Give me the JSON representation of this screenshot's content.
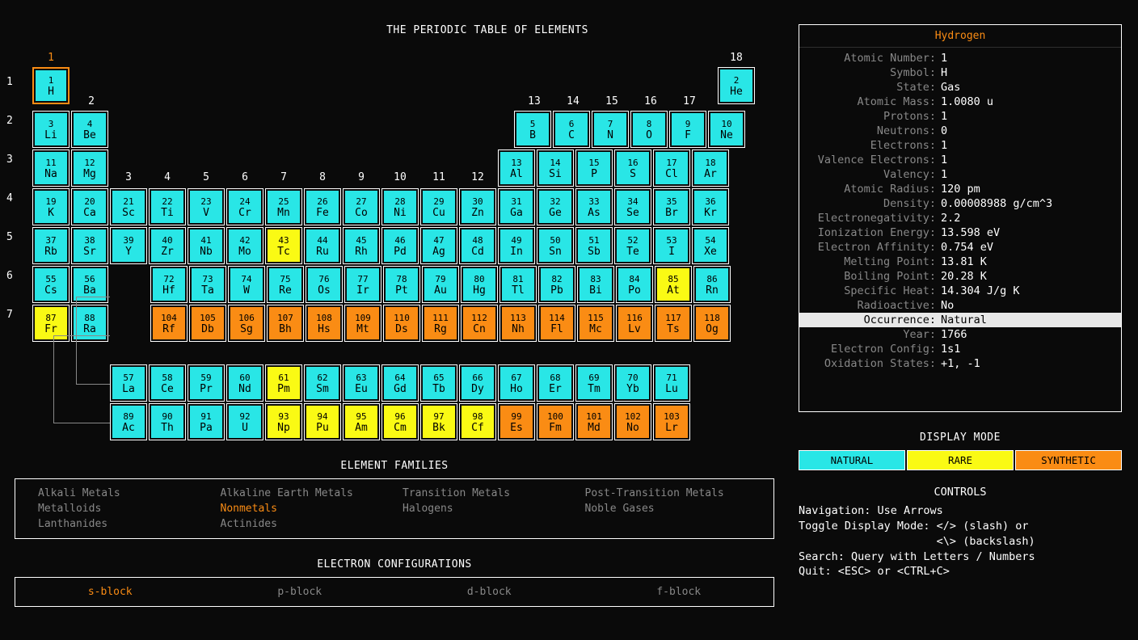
{
  "title": "THE PERIODIC TABLE OF ELEMENTS",
  "selected_element": {
    "name": "Hydrogen",
    "props": [
      {
        "k": "Atomic Number",
        "v": "1"
      },
      {
        "k": "Symbol",
        "v": "H"
      },
      {
        "k": "State",
        "v": "Gas"
      },
      {
        "k": "Atomic Mass",
        "v": "1.0080 u"
      },
      {
        "k": "Protons",
        "v": "1"
      },
      {
        "k": "Neutrons",
        "v": "0"
      },
      {
        "k": "Electrons",
        "v": "1"
      },
      {
        "k": "Valence Electrons",
        "v": "1"
      },
      {
        "k": "Valency",
        "v": "1"
      },
      {
        "k": "Atomic Radius",
        "v": "120 pm"
      },
      {
        "k": "Density",
        "v": "0.00008988 g/cm^3"
      },
      {
        "k": "Electronegativity",
        "v": "2.2"
      },
      {
        "k": "Ionization Energy",
        "v": "13.598 eV"
      },
      {
        "k": "Electron Affinity",
        "v": "0.754 eV"
      },
      {
        "k": "Melting Point",
        "v": "13.81 K"
      },
      {
        "k": "Boiling Point",
        "v": "20.28 K"
      },
      {
        "k": "Specific Heat",
        "v": "14.304 J/g K"
      },
      {
        "k": "Radioactive",
        "v": "No"
      },
      {
        "k": "Occurrence",
        "v": "Natural",
        "hl": true
      },
      {
        "k": "Year",
        "v": "1766"
      },
      {
        "k": "Electron Config",
        "v": "1s1"
      },
      {
        "k": "Oxidation States",
        "v": "+1, -1"
      }
    ]
  },
  "families": {
    "title": "ELEMENT FAMILIES",
    "items": [
      {
        "t": "Alkali Metals"
      },
      {
        "t": "Alkaline Earth Metals"
      },
      {
        "t": "Transition Metals"
      },
      {
        "t": "Post-Transition Metals"
      },
      {
        "t": "Metalloids"
      },
      {
        "t": "Nonmetals",
        "on": true
      },
      {
        "t": "Halogens"
      },
      {
        "t": "Noble Gases"
      },
      {
        "t": "Lanthanides"
      },
      {
        "t": "Actinides"
      }
    ]
  },
  "blocks": {
    "title": "ELECTRON CONFIGURATIONS",
    "items": [
      {
        "t": "s-block",
        "on": true
      },
      {
        "t": "p-block"
      },
      {
        "t": "d-block"
      },
      {
        "t": "f-block"
      }
    ]
  },
  "display_mode": {
    "title": "DISPLAY MODE",
    "items": [
      {
        "t": "NATURAL",
        "c": "mode-nat"
      },
      {
        "t": "RARE",
        "c": "mode-rare"
      },
      {
        "t": "SYNTHETIC",
        "c": "mode-syn"
      }
    ]
  },
  "controls": {
    "title": "CONTROLS",
    "lines": [
      "Navigation: Use Arrows",
      "Toggle Display Mode: </> (slash) or",
      "                     <\\> (backslash)",
      "Search: Query with Letters / Numbers",
      "Quit: <ESC> or <CTRL+C>"
    ]
  },
  "group_numbers": [
    "1",
    "2",
    "3",
    "4",
    "5",
    "6",
    "7",
    "8",
    "9",
    "10",
    "11",
    "12",
    "13",
    "14",
    "15",
    "16",
    "17",
    "18"
  ],
  "period_numbers": [
    "1",
    "2",
    "3",
    "4",
    "5",
    "6",
    "7"
  ],
  "group_label_rows": {
    "row1": {
      "1": "1",
      "18": "18"
    },
    "row2": {
      "2": "2",
      "13": "13",
      "14": "14",
      "15": "15",
      "16": "16",
      "17": "17"
    },
    "row3": {
      "3": "3",
      "4": "4",
      "5": "5",
      "6": "6",
      "7": "7",
      "8": "8",
      "9": "9",
      "10": "10",
      "11": "11",
      "12": "12"
    }
  },
  "elements": {
    "main": [
      [
        {
          "n": 1,
          "s": "H",
          "c": "nat",
          "sel": true
        },
        null,
        null,
        null,
        null,
        null,
        null,
        null,
        null,
        null,
        null,
        null,
        null,
        null,
        null,
        null,
        null,
        {
          "n": 2,
          "s": "He",
          "c": "nat"
        }
      ],
      [
        {
          "n": 3,
          "s": "Li",
          "c": "nat"
        },
        {
          "n": 4,
          "s": "Be",
          "c": "nat"
        },
        null,
        null,
        null,
        null,
        null,
        null,
        null,
        null,
        null,
        null,
        {
          "n": 5,
          "s": "B",
          "c": "nat"
        },
        {
          "n": 6,
          "s": "C",
          "c": "nat"
        },
        {
          "n": 7,
          "s": "N",
          "c": "nat"
        },
        {
          "n": 8,
          "s": "O",
          "c": "nat"
        },
        {
          "n": 9,
          "s": "F",
          "c": "nat"
        },
        {
          "n": 10,
          "s": "Ne",
          "c": "nat"
        }
      ],
      [
        {
          "n": 11,
          "s": "Na",
          "c": "nat"
        },
        {
          "n": 12,
          "s": "Mg",
          "c": "nat"
        },
        null,
        null,
        null,
        null,
        null,
        null,
        null,
        null,
        null,
        null,
        {
          "n": 13,
          "s": "Al",
          "c": "nat"
        },
        {
          "n": 14,
          "s": "Si",
          "c": "nat"
        },
        {
          "n": 15,
          "s": "P",
          "c": "nat"
        },
        {
          "n": 16,
          "s": "S",
          "c": "nat"
        },
        {
          "n": 17,
          "s": "Cl",
          "c": "nat"
        },
        {
          "n": 18,
          "s": "Ar",
          "c": "nat"
        }
      ],
      [
        {
          "n": 19,
          "s": "K",
          "c": "nat"
        },
        {
          "n": 20,
          "s": "Ca",
          "c": "nat"
        },
        {
          "n": 21,
          "s": "Sc",
          "c": "nat"
        },
        {
          "n": 22,
          "s": "Ti",
          "c": "nat"
        },
        {
          "n": 23,
          "s": "V",
          "c": "nat"
        },
        {
          "n": 24,
          "s": "Cr",
          "c": "nat"
        },
        {
          "n": 25,
          "s": "Mn",
          "c": "nat"
        },
        {
          "n": 26,
          "s": "Fe",
          "c": "nat"
        },
        {
          "n": 27,
          "s": "Co",
          "c": "nat"
        },
        {
          "n": 28,
          "s": "Ni",
          "c": "nat"
        },
        {
          "n": 29,
          "s": "Cu",
          "c": "nat"
        },
        {
          "n": 30,
          "s": "Zn",
          "c": "nat"
        },
        {
          "n": 31,
          "s": "Ga",
          "c": "nat"
        },
        {
          "n": 32,
          "s": "Ge",
          "c": "nat"
        },
        {
          "n": 33,
          "s": "As",
          "c": "nat"
        },
        {
          "n": 34,
          "s": "Se",
          "c": "nat"
        },
        {
          "n": 35,
          "s": "Br",
          "c": "nat"
        },
        {
          "n": 36,
          "s": "Kr",
          "c": "nat"
        }
      ],
      [
        {
          "n": 37,
          "s": "Rb",
          "c": "nat"
        },
        {
          "n": 38,
          "s": "Sr",
          "c": "nat"
        },
        {
          "n": 39,
          "s": "Y",
          "c": "nat"
        },
        {
          "n": 40,
          "s": "Zr",
          "c": "nat"
        },
        {
          "n": 41,
          "s": "Nb",
          "c": "nat"
        },
        {
          "n": 42,
          "s": "Mo",
          "c": "nat"
        },
        {
          "n": 43,
          "s": "Tc",
          "c": "rare"
        },
        {
          "n": 44,
          "s": "Ru",
          "c": "nat"
        },
        {
          "n": 45,
          "s": "Rh",
          "c": "nat"
        },
        {
          "n": 46,
          "s": "Pd",
          "c": "nat"
        },
        {
          "n": 47,
          "s": "Ag",
          "c": "nat"
        },
        {
          "n": 48,
          "s": "Cd",
          "c": "nat"
        },
        {
          "n": 49,
          "s": "In",
          "c": "nat"
        },
        {
          "n": 50,
          "s": "Sn",
          "c": "nat"
        },
        {
          "n": 51,
          "s": "Sb",
          "c": "nat"
        },
        {
          "n": 52,
          "s": "Te",
          "c": "nat"
        },
        {
          "n": 53,
          "s": "I",
          "c": "nat"
        },
        {
          "n": 54,
          "s": "Xe",
          "c": "nat"
        }
      ],
      [
        {
          "n": 55,
          "s": "Cs",
          "c": "nat"
        },
        {
          "n": 56,
          "s": "Ba",
          "c": "nat"
        },
        "gap",
        {
          "n": 72,
          "s": "Hf",
          "c": "nat"
        },
        {
          "n": 73,
          "s": "Ta",
          "c": "nat"
        },
        {
          "n": 74,
          "s": "W",
          "c": "nat"
        },
        {
          "n": 75,
          "s": "Re",
          "c": "nat"
        },
        {
          "n": 76,
          "s": "Os",
          "c": "nat"
        },
        {
          "n": 77,
          "s": "Ir",
          "c": "nat"
        },
        {
          "n": 78,
          "s": "Pt",
          "c": "nat"
        },
        {
          "n": 79,
          "s": "Au",
          "c": "nat"
        },
        {
          "n": 80,
          "s": "Hg",
          "c": "nat"
        },
        {
          "n": 81,
          "s": "Tl",
          "c": "nat"
        },
        {
          "n": 82,
          "s": "Pb",
          "c": "nat"
        },
        {
          "n": 83,
          "s": "Bi",
          "c": "nat"
        },
        {
          "n": 84,
          "s": "Po",
          "c": "nat"
        },
        {
          "n": 85,
          "s": "At",
          "c": "rare"
        },
        {
          "n": 86,
          "s": "Rn",
          "c": "nat"
        }
      ],
      [
        {
          "n": 87,
          "s": "Fr",
          "c": "rare"
        },
        {
          "n": 88,
          "s": "Ra",
          "c": "nat"
        },
        "gap",
        {
          "n": 104,
          "s": "Rf",
          "c": "syn"
        },
        {
          "n": 105,
          "s": "Db",
          "c": "syn"
        },
        {
          "n": 106,
          "s": "Sg",
          "c": "syn"
        },
        {
          "n": 107,
          "s": "Bh",
          "c": "syn"
        },
        {
          "n": 108,
          "s": "Hs",
          "c": "syn"
        },
        {
          "n": 109,
          "s": "Mt",
          "c": "syn"
        },
        {
          "n": 110,
          "s": "Ds",
          "c": "syn"
        },
        {
          "n": 111,
          "s": "Rg",
          "c": "syn"
        },
        {
          "n": 112,
          "s": "Cn",
          "c": "syn"
        },
        {
          "n": 113,
          "s": "Nh",
          "c": "syn"
        },
        {
          "n": 114,
          "s": "Fl",
          "c": "syn"
        },
        {
          "n": 115,
          "s": "Mc",
          "c": "syn"
        },
        {
          "n": 116,
          "s": "Lv",
          "c": "syn"
        },
        {
          "n": 117,
          "s": "Ts",
          "c": "syn"
        },
        {
          "n": 118,
          "s": "Og",
          "c": "syn"
        }
      ]
    ],
    "lan": [
      {
        "n": 57,
        "s": "La",
        "c": "nat"
      },
      {
        "n": 58,
        "s": "Ce",
        "c": "nat"
      },
      {
        "n": 59,
        "s": "Pr",
        "c": "nat"
      },
      {
        "n": 60,
        "s": "Nd",
        "c": "nat"
      },
      {
        "n": 61,
        "s": "Pm",
        "c": "rare"
      },
      {
        "n": 62,
        "s": "Sm",
        "c": "nat"
      },
      {
        "n": 63,
        "s": "Eu",
        "c": "nat"
      },
      {
        "n": 64,
        "s": "Gd",
        "c": "nat"
      },
      {
        "n": 65,
        "s": "Tb",
        "c": "nat"
      },
      {
        "n": 66,
        "s": "Dy",
        "c": "nat"
      },
      {
        "n": 67,
        "s": "Ho",
        "c": "nat"
      },
      {
        "n": 68,
        "s": "Er",
        "c": "nat"
      },
      {
        "n": 69,
        "s": "Tm",
        "c": "nat"
      },
      {
        "n": 70,
        "s": "Yb",
        "c": "nat"
      },
      {
        "n": 71,
        "s": "Lu",
        "c": "nat"
      }
    ],
    "act": [
      {
        "n": 89,
        "s": "Ac",
        "c": "nat"
      },
      {
        "n": 90,
        "s": "Th",
        "c": "nat"
      },
      {
        "n": 91,
        "s": "Pa",
        "c": "nat"
      },
      {
        "n": 92,
        "s": "U",
        "c": "nat"
      },
      {
        "n": 93,
        "s": "Np",
        "c": "rare"
      },
      {
        "n": 94,
        "s": "Pu",
        "c": "rare"
      },
      {
        "n": 95,
        "s": "Am",
        "c": "rare"
      },
      {
        "n": 96,
        "s": "Cm",
        "c": "rare"
      },
      {
        "n": 97,
        "s": "Bk",
        "c": "rare"
      },
      {
        "n": 98,
        "s": "Cf",
        "c": "rare"
      },
      {
        "n": 99,
        "s": "Es",
        "c": "syn"
      },
      {
        "n": 100,
        "s": "Fm",
        "c": "syn"
      },
      {
        "n": 101,
        "s": "Md",
        "c": "syn"
      },
      {
        "n": 102,
        "s": "No",
        "c": "syn"
      },
      {
        "n": 103,
        "s": "Lr",
        "c": "syn"
      }
    ]
  }
}
